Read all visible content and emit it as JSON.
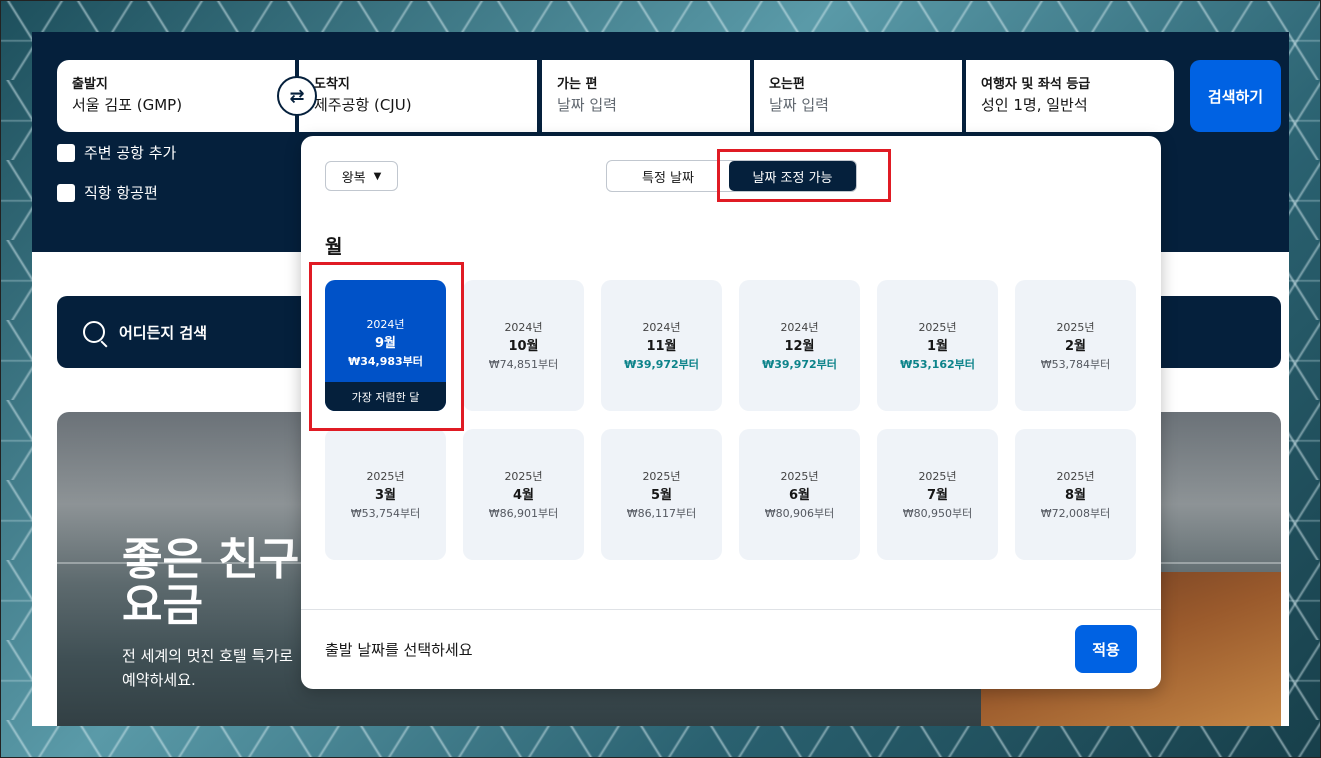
{
  "search": {
    "origin": {
      "label": "출발지",
      "value": "서울 김포 (GMP)"
    },
    "destination": {
      "label": "도착지",
      "value": "제주공항 (CJU)"
    },
    "depart": {
      "label": "가는 편",
      "placeholder": "날짜 입력"
    },
    "return": {
      "label": "오는편",
      "placeholder": "날짜 입력"
    },
    "travellers": {
      "label": "여행자 및 좌석 등급",
      "value": "성인 1명, 일반석"
    },
    "swap_icon": "swap-arrows",
    "search_button": "검색하기",
    "nearby_airports": "주변 공항 추가",
    "direct_flights": "직항 항공편"
  },
  "anywhere": {
    "label": "어디든지 검색",
    "icon": "globe-search"
  },
  "hero": {
    "title_line1": "좋은 친구",
    "title_line2": "요금",
    "subtitle_line1": "전 세계의 멋진 호텔 특가로",
    "subtitle_line2": "예약하세요."
  },
  "popup": {
    "trip_type": "왕복",
    "tab_specific": "특정 날짜",
    "tab_flexible": "날짜 조정 가능",
    "month_heading": "월",
    "cheapest_tag": "가장 저렴한 달",
    "footer_message": "출발 날짜를 선택하세요",
    "apply": "적용",
    "months": [
      {
        "year": "2024년",
        "month": "9월",
        "price": "₩34,983부터",
        "selected": true,
        "cheapest": true
      },
      {
        "year": "2024년",
        "month": "10월",
        "price": "₩74,851부터"
      },
      {
        "year": "2024년",
        "month": "11월",
        "price": "₩39,972부터",
        "cheap": true
      },
      {
        "year": "2024년",
        "month": "12월",
        "price": "₩39,972부터",
        "cheap": true
      },
      {
        "year": "2025년",
        "month": "1월",
        "price": "₩53,162부터",
        "cheap": true
      },
      {
        "year": "2025년",
        "month": "2월",
        "price": "₩53,784부터"
      },
      {
        "year": "2025년",
        "month": "3월",
        "price": "₩53,754부터"
      },
      {
        "year": "2025년",
        "month": "4월",
        "price": "₩86,901부터"
      },
      {
        "year": "2025년",
        "month": "5월",
        "price": "₩86,117부터"
      },
      {
        "year": "2025년",
        "month": "6월",
        "price": "₩80,906부터"
      },
      {
        "year": "2025년",
        "month": "7월",
        "price": "₩80,950부터"
      },
      {
        "year": "2025년",
        "month": "8월",
        "price": "₩72,008부터"
      }
    ]
  },
  "colors": {
    "navy": "#05203c",
    "primary": "#0062e3",
    "selected": "#0052c8",
    "cheap": "#0c838a",
    "highlight": "#e01b24"
  }
}
